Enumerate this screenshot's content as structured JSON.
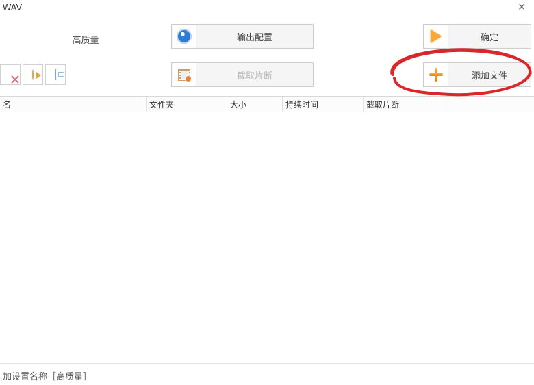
{
  "title": "WAV",
  "quality_label": "高质量",
  "buttons": {
    "output_config": "输出配置",
    "confirm": "确定",
    "clip_segment": "截取片断",
    "add_file": "添加文件"
  },
  "columns": {
    "name": "名",
    "folder": "文件夹",
    "size": "大小",
    "duration": "持续时间",
    "clip": "截取片断"
  },
  "footer": "加设置名称［高质量］",
  "table_rows": [],
  "annotation": {
    "target": "add-file-button",
    "style": "red-freehand-ellipse"
  }
}
